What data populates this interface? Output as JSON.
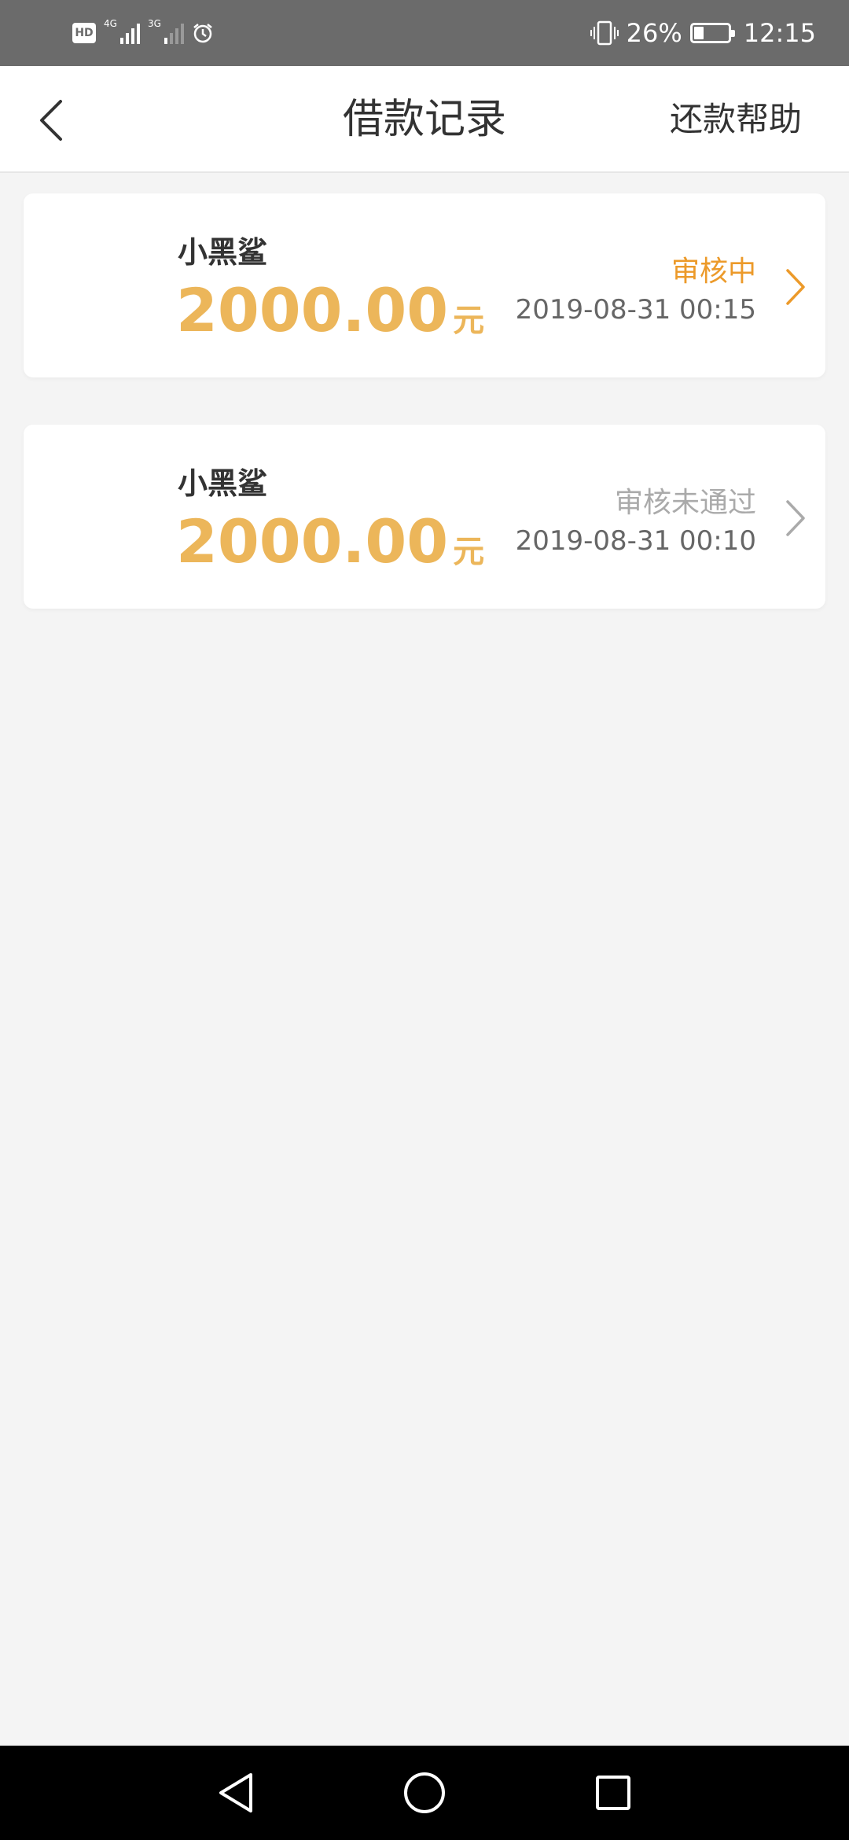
{
  "status_bar": {
    "hd": "HD",
    "net1": "4G",
    "net2": "3G",
    "battery_level": 0.26,
    "battery_text": "26%",
    "time": "12:15"
  },
  "header": {
    "title": "借款记录",
    "help_label": "还款帮助",
    "back_icon": "chevron-left-icon"
  },
  "records": [
    {
      "name": "小黑鲨",
      "amount": "2000.00",
      "unit": "元",
      "status": "审核中",
      "status_color": "#ec9a2a",
      "chevron_color": "#ec9a2a",
      "date": "2019-08-31 00:15"
    },
    {
      "name": "小黑鲨",
      "amount": "2000.00",
      "unit": "元",
      "status": "审核未通过",
      "status_color": "#aaaaaa",
      "chevron_color": "#aaaaaa",
      "date": "2019-08-31 00:10"
    }
  ],
  "nav": {
    "back_icon": "triangle-back-icon",
    "home_icon": "circle-home-icon",
    "recents_icon": "square-recents-icon"
  },
  "colors": {
    "accent": "#ecb65a",
    "pending": "#ec9a2a",
    "rejected": "#aaaaaa",
    "background": "#f4f4f4"
  }
}
